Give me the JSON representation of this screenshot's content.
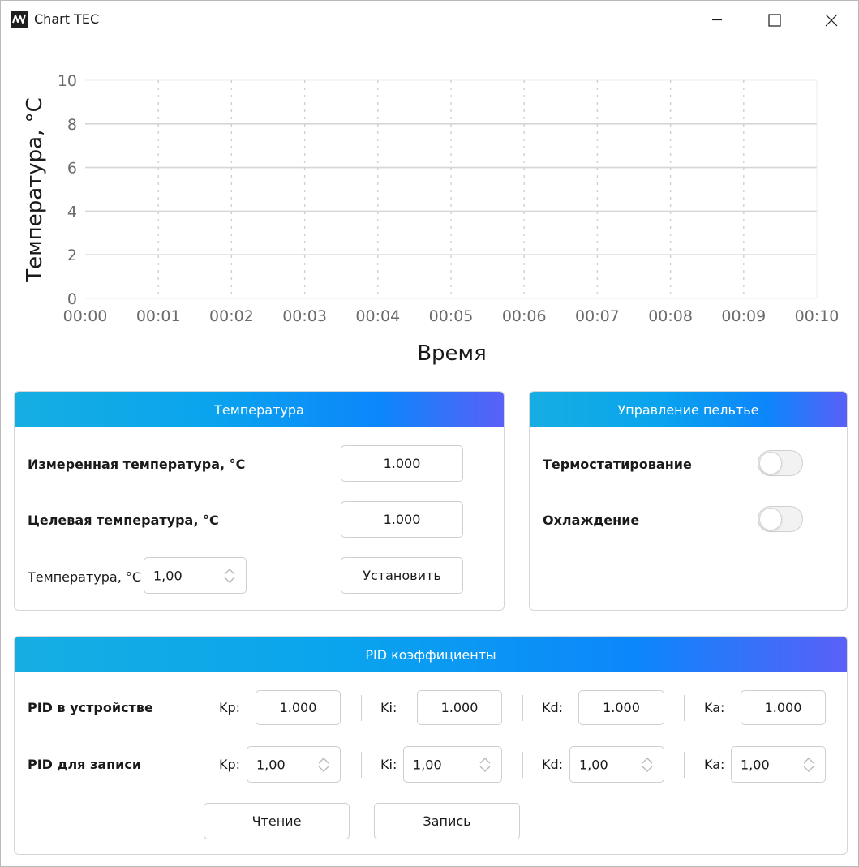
{
  "window": {
    "title": "Chart TEC",
    "controls": {
      "minimize": "minimize-icon",
      "maximize": "maximize-icon",
      "close": "close-icon"
    }
  },
  "chart_data": {
    "type": "line",
    "title": "",
    "xlabel": "Время",
    "ylabel": "Температура, °C",
    "x_ticks": [
      "00:00",
      "00:01",
      "00:02",
      "00:03",
      "00:04",
      "00:05",
      "00:06",
      "00:07",
      "00:08",
      "00:09",
      "00:10"
    ],
    "y_ticks": [
      "0",
      "2",
      "4",
      "6",
      "8",
      "10"
    ],
    "ylim": [
      0,
      10
    ],
    "xlim": [
      "00:00",
      "00:10"
    ],
    "series": [],
    "grid": true
  },
  "temperature_panel": {
    "header": "Температура",
    "measured_label": "Измеренная температура, °C",
    "measured_value": "1.000",
    "target_label": "Целевая температура, °C",
    "target_value": "1.000",
    "set_label": "Температура, °C",
    "set_value": "1,00",
    "set_button": "Установить"
  },
  "peltier_panel": {
    "header": "Управление пельтье",
    "thermostat_label": "Термостатирование",
    "thermostat_on": false,
    "cooling_label": "Охлаждение",
    "cooling_on": false
  },
  "pid_panel": {
    "header": "PID коэффициенты",
    "device_label": "PID в устройстве",
    "write_label": "PID для записи",
    "coefficients": [
      {
        "name": "Kp:",
        "device_value": "1.000",
        "write_value": "1,00"
      },
      {
        "name": "Ki:",
        "device_value": "1.000",
        "write_value": "1,00"
      },
      {
        "name": "Kd:",
        "device_value": "1.000",
        "write_value": "1,00"
      },
      {
        "name": "Ka:",
        "device_value": "1.000",
        "write_value": "1,00"
      }
    ],
    "read_button": "Чтение",
    "write_button": "Запись"
  },
  "colors": {
    "header_gradient": [
      "#16aee2",
      "#0aa4ee",
      "#0c86fb",
      "#5a60f8"
    ],
    "grid": "#d6d6d6",
    "axis_text": "#6b6b6b"
  }
}
